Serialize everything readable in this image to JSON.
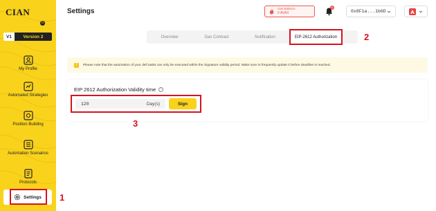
{
  "sidebar": {
    "logo": "CIAN",
    "logo_badge": "G",
    "version": {
      "v1": "V1",
      "v2": "Version 2"
    },
    "items": [
      {
        "label": "My Profile",
        "icon": "profile-icon"
      },
      {
        "label": "Automated Strategies",
        "icon": "strategy-icon"
      },
      {
        "label": "Position Building",
        "icon": "position-icon"
      },
      {
        "label": "Automation Scenarios",
        "icon": "scenarios-icon"
      },
      {
        "label": "Protocols",
        "icon": "protocols-icon"
      },
      {
        "label": "Settings",
        "icon": "gear-icon"
      }
    ]
  },
  "header": {
    "title": "Settings",
    "gas_balance": {
      "label": "Gas Balance",
      "value": "0 AVAX"
    },
    "notification_count": "0",
    "wallet_address": "0x8F1a...1b6D",
    "chain": "avalanche-icon"
  },
  "tabs": [
    {
      "label": "Overview"
    },
    {
      "label": "Gas Contract"
    },
    {
      "label": "Notification"
    },
    {
      "label": "EIP-2612 Authorization",
      "active": true
    }
  ],
  "notice": "Please note that the automation of your defi tasks can only be executed within the Signature validity period. Make sure to frequently update it before deadline is reached.",
  "authorization": {
    "title": "EIP 2612 Authorization Validity time",
    "input_value": "120",
    "unit": "Day(s)",
    "sign_label": "Sign"
  },
  "annotations": {
    "a1": "1",
    "a2": "2",
    "a3": "3"
  },
  "colors": {
    "brand_yellow": "#f9d21c",
    "annotation_red": "#d6121e"
  }
}
